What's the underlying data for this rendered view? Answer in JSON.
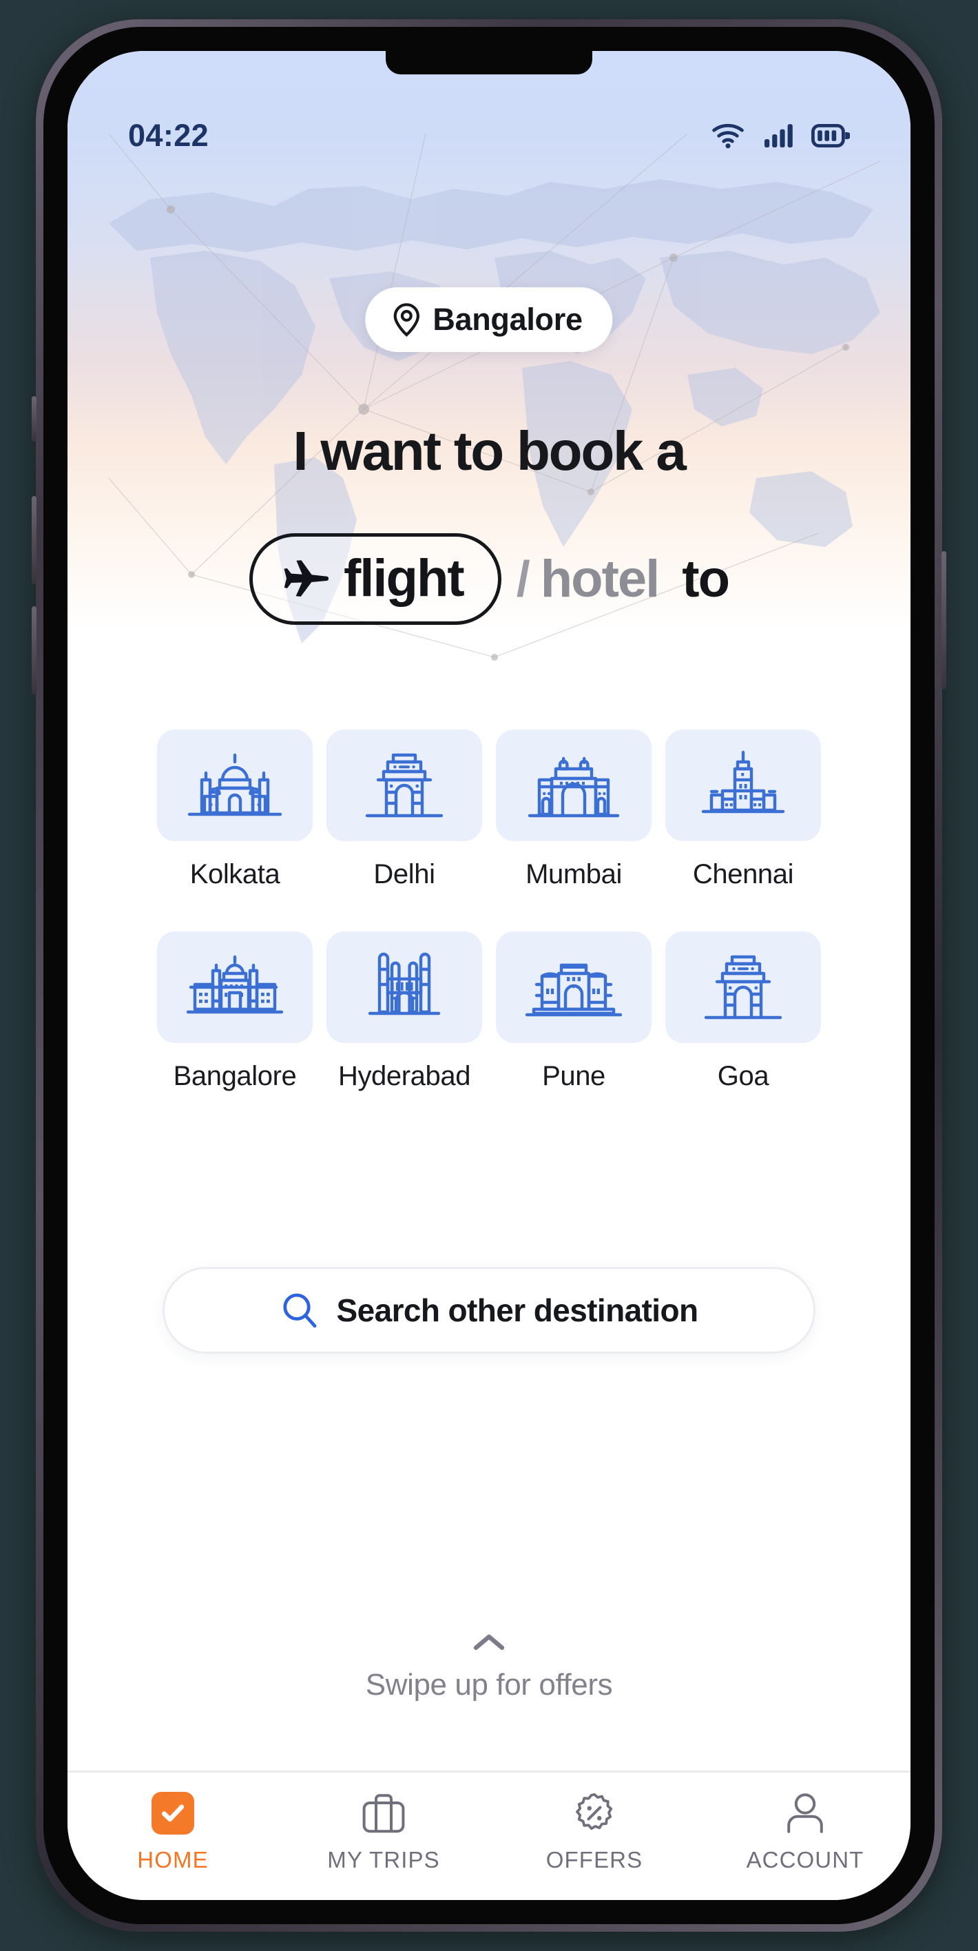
{
  "status_bar": {
    "time": "04:22",
    "icons": [
      "wifi-icon",
      "cellular-signal-icon",
      "battery-icon"
    ]
  },
  "location_chip": {
    "icon": "map-pin-icon",
    "label": "Bangalore"
  },
  "headline": {
    "line1": "I want to book a",
    "flight_label": "flight",
    "flight_icon": "airplane-icon",
    "separator": "/",
    "hotel_label": "hotel",
    "trailing": "to",
    "selected": "flight"
  },
  "cities": [
    {
      "name": "Kolkata",
      "icon": "victoria-memorial-icon"
    },
    {
      "name": "Delhi",
      "icon": "india-gate-icon"
    },
    {
      "name": "Mumbai",
      "icon": "gateway-of-india-icon"
    },
    {
      "name": "Chennai",
      "icon": "chennai-clock-tower-icon"
    },
    {
      "name": "Bangalore",
      "icon": "vidhana-soudha-icon"
    },
    {
      "name": "Hyderabad",
      "icon": "charminar-icon"
    },
    {
      "name": "Pune",
      "icon": "aga-khan-palace-icon"
    },
    {
      "name": "Goa",
      "icon": "goa-arch-icon"
    }
  ],
  "search": {
    "icon": "search-icon",
    "placeholder": "Search other destination",
    "value": ""
  },
  "offers_hint": {
    "icon": "chevron-up-icon",
    "label": "Swipe up for offers"
  },
  "tabs": [
    {
      "label": "HOME",
      "icon": "check-square-icon",
      "active": true
    },
    {
      "label": "MY TRIPS",
      "icon": "suitcase-icon",
      "active": false
    },
    {
      "label": "OFFERS",
      "icon": "discount-badge-icon",
      "active": false
    },
    {
      "label": "ACCOUNT",
      "icon": "person-icon",
      "active": false
    }
  ],
  "colors": {
    "accent": "#f47a2a",
    "tile_bg": "#e9f0fc",
    "monument_blue": "#3b6fd4",
    "status_navy": "#1c3566",
    "muted_gray": "#82828d"
  }
}
